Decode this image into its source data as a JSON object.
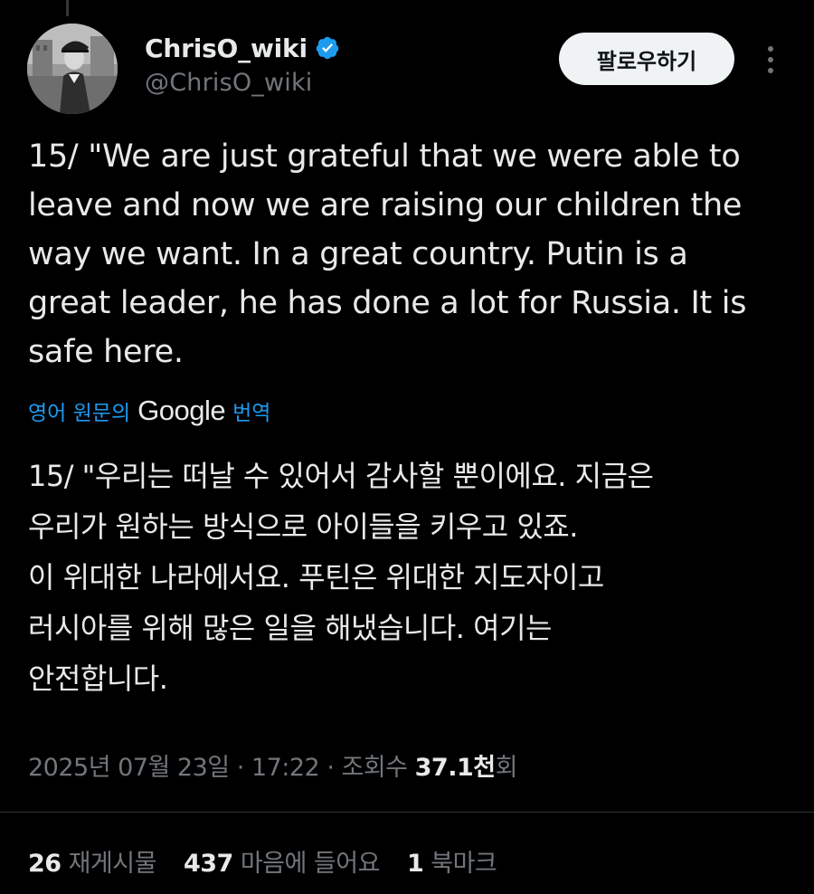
{
  "author": {
    "display_name": "ChrisO_wiki",
    "handle": "@ChrisO_wiki"
  },
  "follow_button_label": "팔로우하기",
  "tweet": {
    "text": "15/ \"We are just grateful that we were able to\nleave and now we are raising our children the\nway we want. In a great country. Putin is a\ngreat leader, he has done a lot for Russia. It is\nsafe here.",
    "translate": {
      "prefix": "영어 원문의",
      "brand": "Google",
      "suffix": "번역"
    },
    "translated_text": "15/ \"우리는 떠날 수 있어서 감사할 뿐이에요. 지금은\n우리가 원하는 방식으로 아이들을 키우고 있죠.\n이 위대한 나라에서요. 푸틴은 위대한 지도자이고\n러시아를 위해 많은 일을 해냈습니다. 여기는\n안전합니다.",
    "date": "2025년 07월 23일",
    "separator": "·",
    "time": "17:22",
    "views_label": "조회수",
    "views_count": "37.1천",
    "views_suffix": "회"
  },
  "stats": [
    {
      "count": "26",
      "label": "재게시물"
    },
    {
      "count": "437",
      "label": "마음에 들어요"
    },
    {
      "count": "1",
      "label": "북마크"
    }
  ],
  "colors": {
    "background": "#000000",
    "text": "#e7e9ea",
    "secondary": "#71767b",
    "accent": "#1d9bf0",
    "follow_bg": "#eff3f4"
  },
  "icons": {
    "verified": "verified-badge-icon",
    "more": "more-options-icon"
  }
}
